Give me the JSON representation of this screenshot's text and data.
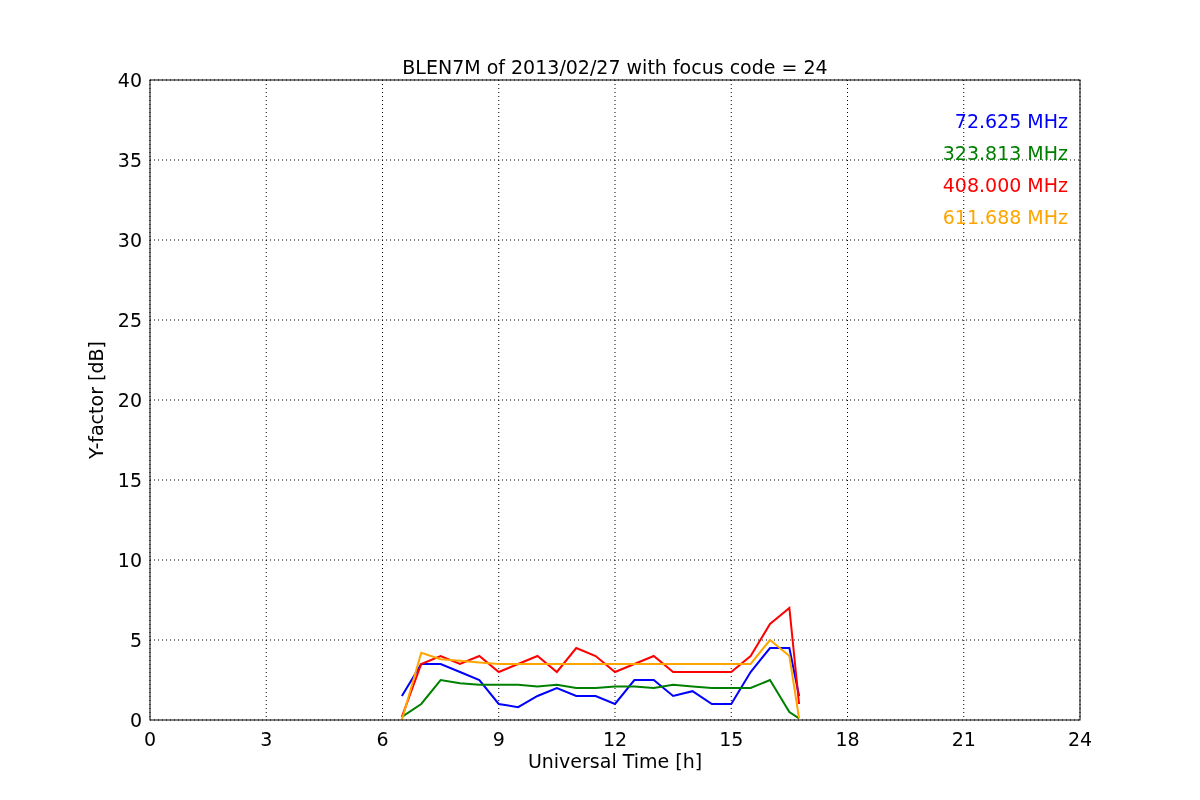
{
  "figure": {
    "chart_data": {
      "type": "line",
      "grid": true,
      "title": "BLEN7M of 2013/02/27 with focus code = 24",
      "xlabel": "Universal Time [h]",
      "ylabel": "Y-factor [dB]",
      "xlim": [
        0,
        24
      ],
      "ylim": [
        0,
        40
      ],
      "xticks": [
        0,
        3,
        6,
        9,
        12,
        15,
        18,
        21,
        24
      ],
      "yticks": [
        0,
        5,
        10,
        15,
        20,
        25,
        30,
        35,
        40
      ],
      "x": [
        6.5,
        7,
        7.5,
        8,
        8.5,
        9,
        9.5,
        10,
        10.5,
        11,
        11.5,
        12,
        12.5,
        13,
        13.5,
        14,
        14.5,
        15,
        15.5,
        16,
        16.5,
        16.75
      ],
      "series": [
        {
          "name": "72.625 MHz",
          "color": "#0000ff",
          "values": [
            1.5,
            3.5,
            3.5,
            3.0,
            2.5,
            1.0,
            0.8,
            1.5,
            2.0,
            1.5,
            1.5,
            1.0,
            2.5,
            2.5,
            1.5,
            1.8,
            1.0,
            1.0,
            3.0,
            4.5,
            4.5,
            1.5
          ]
        },
        {
          "name": "323.813 MHz",
          "color": "#008000",
          "values": [
            0.2,
            1.0,
            2.5,
            2.3,
            2.2,
            2.2,
            2.2,
            2.1,
            2.2,
            2.0,
            2.0,
            2.1,
            2.1,
            2.0,
            2.2,
            2.1,
            2.0,
            2.0,
            2.0,
            2.5,
            0.5,
            0.1
          ]
        },
        {
          "name": "408.000 MHz",
          "color": "#ff0000",
          "values": [
            0.2,
            3.5,
            4.0,
            3.5,
            4.0,
            3.0,
            3.5,
            4.0,
            3.0,
            4.5,
            4.0,
            3.0,
            3.5,
            4.0,
            3.0,
            3.0,
            3.0,
            3.0,
            4.0,
            6.0,
            7.0,
            1.0
          ]
        },
        {
          "name": "611.688 MHz",
          "color": "#ffa500",
          "values": [
            0.0,
            4.2,
            3.8,
            3.7,
            3.6,
            3.5,
            3.5,
            3.5,
            3.5,
            3.5,
            3.5,
            3.5,
            3.5,
            3.5,
            3.5,
            3.5,
            3.5,
            3.5,
            3.5,
            5.0,
            4.0,
            0.1
          ]
        }
      ]
    }
  }
}
